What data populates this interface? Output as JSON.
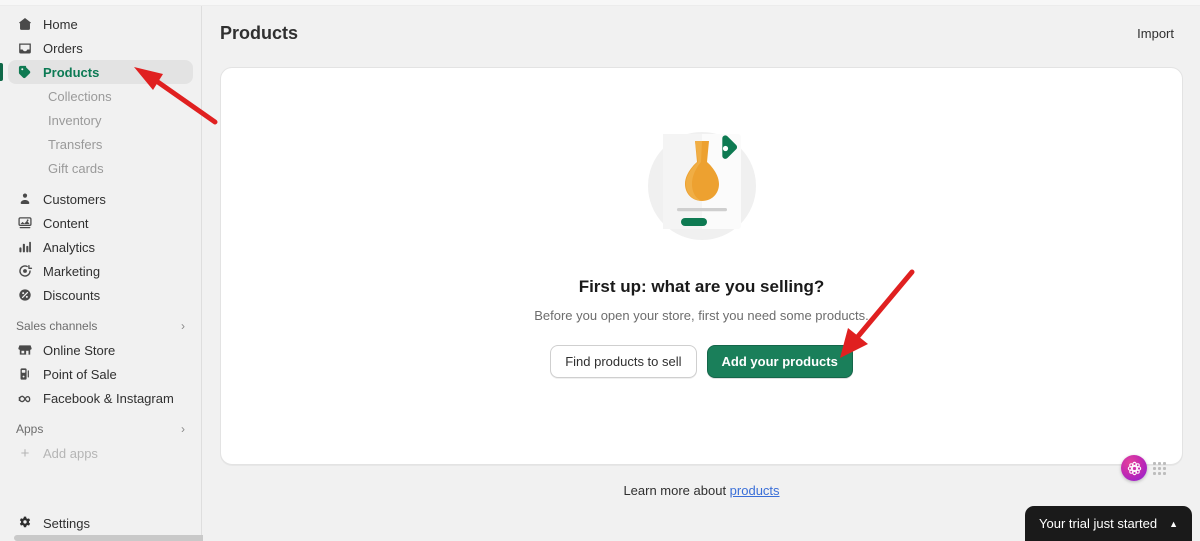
{
  "sidebar": {
    "items": [
      {
        "label": "Home",
        "icon": "home-icon",
        "level": "top",
        "state": "default"
      },
      {
        "label": "Orders",
        "icon": "orders-icon",
        "level": "top",
        "state": "default"
      },
      {
        "label": "Products",
        "icon": "products-tag-icon",
        "level": "top",
        "state": "selected"
      },
      {
        "label": "Collections",
        "icon": "none",
        "level": "child",
        "state": "muted"
      },
      {
        "label": "Inventory",
        "icon": "none",
        "level": "child",
        "state": "muted"
      },
      {
        "label": "Transfers",
        "icon": "none",
        "level": "child",
        "state": "muted"
      },
      {
        "label": "Gift cards",
        "icon": "none",
        "level": "child",
        "state": "muted"
      },
      {
        "label": "Customers",
        "icon": "customers-icon",
        "level": "top",
        "state": "default"
      },
      {
        "label": "Content",
        "icon": "content-icon",
        "level": "top",
        "state": "default"
      },
      {
        "label": "Analytics",
        "icon": "analytics-icon",
        "level": "top",
        "state": "default"
      },
      {
        "label": "Marketing",
        "icon": "marketing-icon",
        "level": "top",
        "state": "default"
      },
      {
        "label": "Discounts",
        "icon": "discounts-icon",
        "level": "top",
        "state": "default"
      }
    ],
    "sales_channels": {
      "title": "Sales channels",
      "chevron": "›",
      "items": [
        {
          "label": "Online Store",
          "icon": "store-icon"
        },
        {
          "label": "Point of Sale",
          "icon": "pos-icon"
        },
        {
          "label": "Facebook & Instagram",
          "icon": "facebook-instagram-icon"
        }
      ]
    },
    "apps": {
      "title": "Apps",
      "chevron": "›",
      "add_label": "Add apps",
      "add_icon": "plus-icon"
    },
    "settings": {
      "label": "Settings",
      "icon": "gear-icon"
    }
  },
  "header": {
    "title": "Products",
    "import_label": "Import"
  },
  "empty_state": {
    "illustration": "product-card-vase-illustration",
    "title": "First up: what are you selling?",
    "subtitle": "Before you open your store, first you need some products.",
    "primary_button": "Add your products",
    "secondary_button": "Find products to sell"
  },
  "footer": {
    "learn_prefix": "Learn more about ",
    "learn_link": "products"
  },
  "helper_widget": {
    "orb_icon": "assistant-orb-icon",
    "drag_handle_icon": "drag-dots-icon"
  },
  "trial_banner": {
    "label": "Your trial just started",
    "caret": "▲"
  },
  "colors": {
    "accent_green": "#1a7f5a",
    "selected_text": "#0c7a54",
    "link_blue": "#3a6fd8",
    "annotation_red": "#e02020",
    "sidebar_bg": "#f1f1f1",
    "card_bg": "#ffffff",
    "illustration_orange": "#eda130",
    "illustration_green": "#0e7a52"
  },
  "annotations": [
    {
      "name": "arrow-to-products-nav",
      "color": "#e02020"
    },
    {
      "name": "arrow-to-add-your-products-button",
      "color": "#e02020"
    }
  ]
}
